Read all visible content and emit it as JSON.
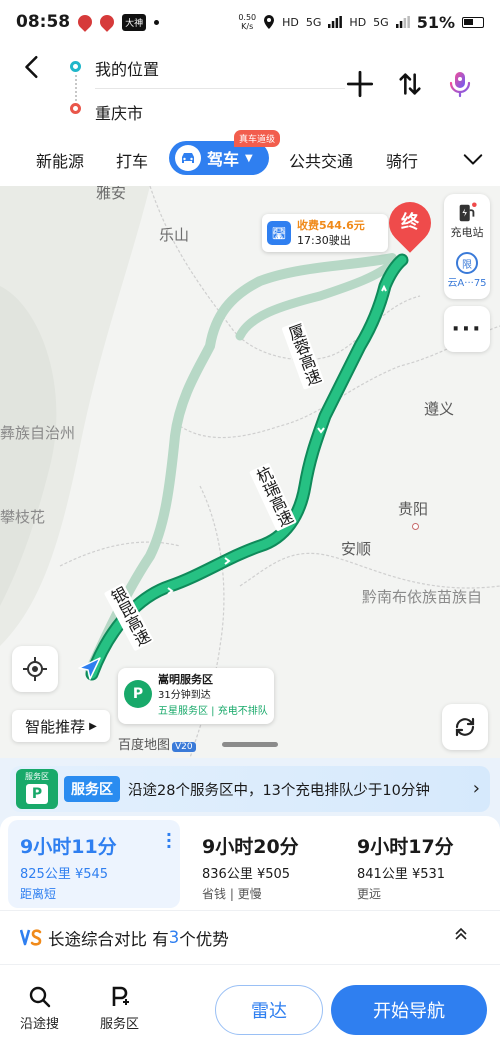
{
  "status_bar": {
    "time": "08:58",
    "app_badge": "大神",
    "speed_value": "0.50",
    "speed_unit": "K/s",
    "hd1": "HD",
    "net1": "5G",
    "hd2": "HD",
    "net2": "5G",
    "battery": "51%"
  },
  "route": {
    "from": "我的位置",
    "to": "重庆市"
  },
  "tabs": {
    "new_energy": "新能源",
    "taxi": "打车",
    "drive": "驾车",
    "drive_badge": "真车道级",
    "transit": "公共交通",
    "ride": "骑行"
  },
  "map": {
    "labels": {
      "yaan": "雅安",
      "leshan": "乐山",
      "zunyi": "遵义",
      "guiyang": "贵阳",
      "anshun": "安顺",
      "qiannan": "黔南布依族苗族自",
      "yizu": "彝族自治州",
      "panzhihua": "攀枝花"
    },
    "side_rail": {
      "charging": "充电站",
      "limit_caption": "云A···75"
    },
    "toll": {
      "fee": "收费544.6元",
      "exit": "17:30驶出"
    },
    "end_marker": "终",
    "roads": {
      "xiarong": "厦蓉高速",
      "hangrui": "杭瑞高速",
      "yinkun": "银昆高速"
    },
    "service_popup": {
      "name": "嵩明服务区",
      "eta": "31分钟到达",
      "tags": "五星服务区 | 充电不排队"
    },
    "smart_recommend": "智能推荐",
    "logo_text": "百度地图",
    "logo_version": "V20"
  },
  "sheet": {
    "service_banner": {
      "badge_text": "服务区",
      "tag": "服务区",
      "text": "沿途28个服务区中，13个充电排队少于10分钟"
    },
    "routes": [
      {
        "time": "9小时11分",
        "distance": "825公里",
        "toll": "¥545",
        "note": "距离短"
      },
      {
        "time": "9小时20分",
        "distance": "836公里",
        "toll": "¥505",
        "note": "省钱 | 更慢"
      },
      {
        "time": "9小时17分",
        "distance": "841公里",
        "toll": "¥531",
        "note": "更远"
      }
    ],
    "compare": {
      "prefix": "长途综合对比 有",
      "count": "3",
      "suffix": "个优势"
    },
    "bottom": {
      "along_search": "沿途搜",
      "service_area": "服务区",
      "radar": "雷达",
      "start_nav": "开始导航"
    }
  },
  "colors": {
    "accent": "#2f7ff0",
    "route_green": "#1fb57a",
    "alt_route": "#b7d8c6",
    "end_red": "#ef4b4b"
  }
}
